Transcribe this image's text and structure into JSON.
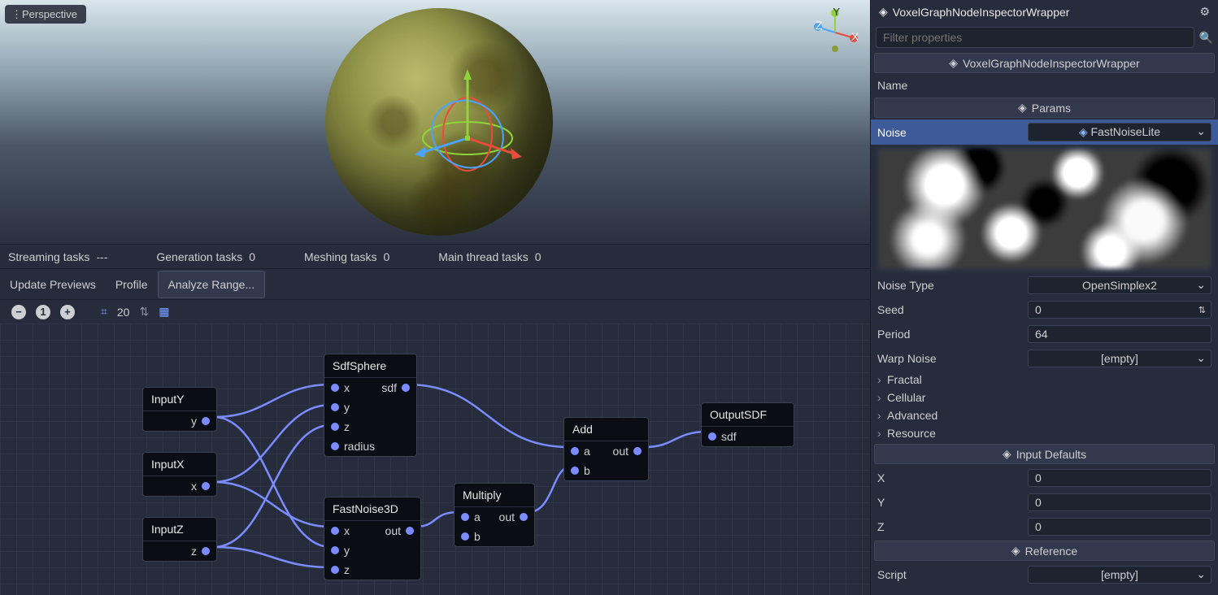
{
  "viewport": {
    "button": "Perspective"
  },
  "axis_widget": {
    "x": "X",
    "y": "Y",
    "z": "Z"
  },
  "status": {
    "streaming": {
      "label": "Streaming tasks",
      "value": "---"
    },
    "generation": {
      "label": "Generation tasks",
      "value": "0"
    },
    "meshing": {
      "label": "Meshing tasks",
      "value": "0"
    },
    "mainthread": {
      "label": "Main thread tasks",
      "value": "0"
    }
  },
  "toolbar": {
    "update_previews": "Update Previews",
    "profile": "Profile",
    "analyze_range": "Analyze Range..."
  },
  "graph_toolbar": {
    "zoom": "20"
  },
  "nodes": {
    "inputY": {
      "title": "InputY",
      "out": "y"
    },
    "inputX": {
      "title": "InputX",
      "out": "x"
    },
    "inputZ": {
      "title": "InputZ",
      "out": "z"
    },
    "sdfSphere": {
      "title": "SdfSphere",
      "in": [
        "x",
        "y",
        "z",
        "radius"
      ],
      "out": "sdf"
    },
    "fastNoise": {
      "title": "FastNoise3D",
      "in": [
        "x",
        "y",
        "z"
      ],
      "out": "out"
    },
    "multiply": {
      "title": "Multiply",
      "in": [
        "a",
        "b"
      ],
      "out": "out"
    },
    "add": {
      "title": "Add",
      "in": [
        "a",
        "b"
      ],
      "out": "out"
    },
    "outputSDF": {
      "title": "OutputSDF",
      "in": "sdf"
    }
  },
  "inspector": {
    "header": "VoxelGraphNodeInspectorWrapper",
    "filter_placeholder": "Filter properties",
    "class_line": "VoxelGraphNodeInspectorWrapper",
    "name_label": "Name",
    "params_header": "Params",
    "noise_label": "Noise",
    "noise_resource": "FastNoiseLite",
    "noise_type": {
      "label": "Noise Type",
      "value": "OpenSimplex2"
    },
    "seed": {
      "label": "Seed",
      "value": "0"
    },
    "period": {
      "label": "Period",
      "value": "64"
    },
    "warp_noise": {
      "label": "Warp Noise",
      "value": "[empty]"
    },
    "fractal": "Fractal",
    "cellular": "Cellular",
    "advanced": "Advanced",
    "resource": "Resource",
    "input_defaults_header": "Input Defaults",
    "x": {
      "label": "X",
      "value": "0"
    },
    "y": {
      "label": "Y",
      "value": "0"
    },
    "z": {
      "label": "Z",
      "value": "0"
    },
    "reference_header": "Reference",
    "script": {
      "label": "Script",
      "value": "[empty]"
    }
  }
}
